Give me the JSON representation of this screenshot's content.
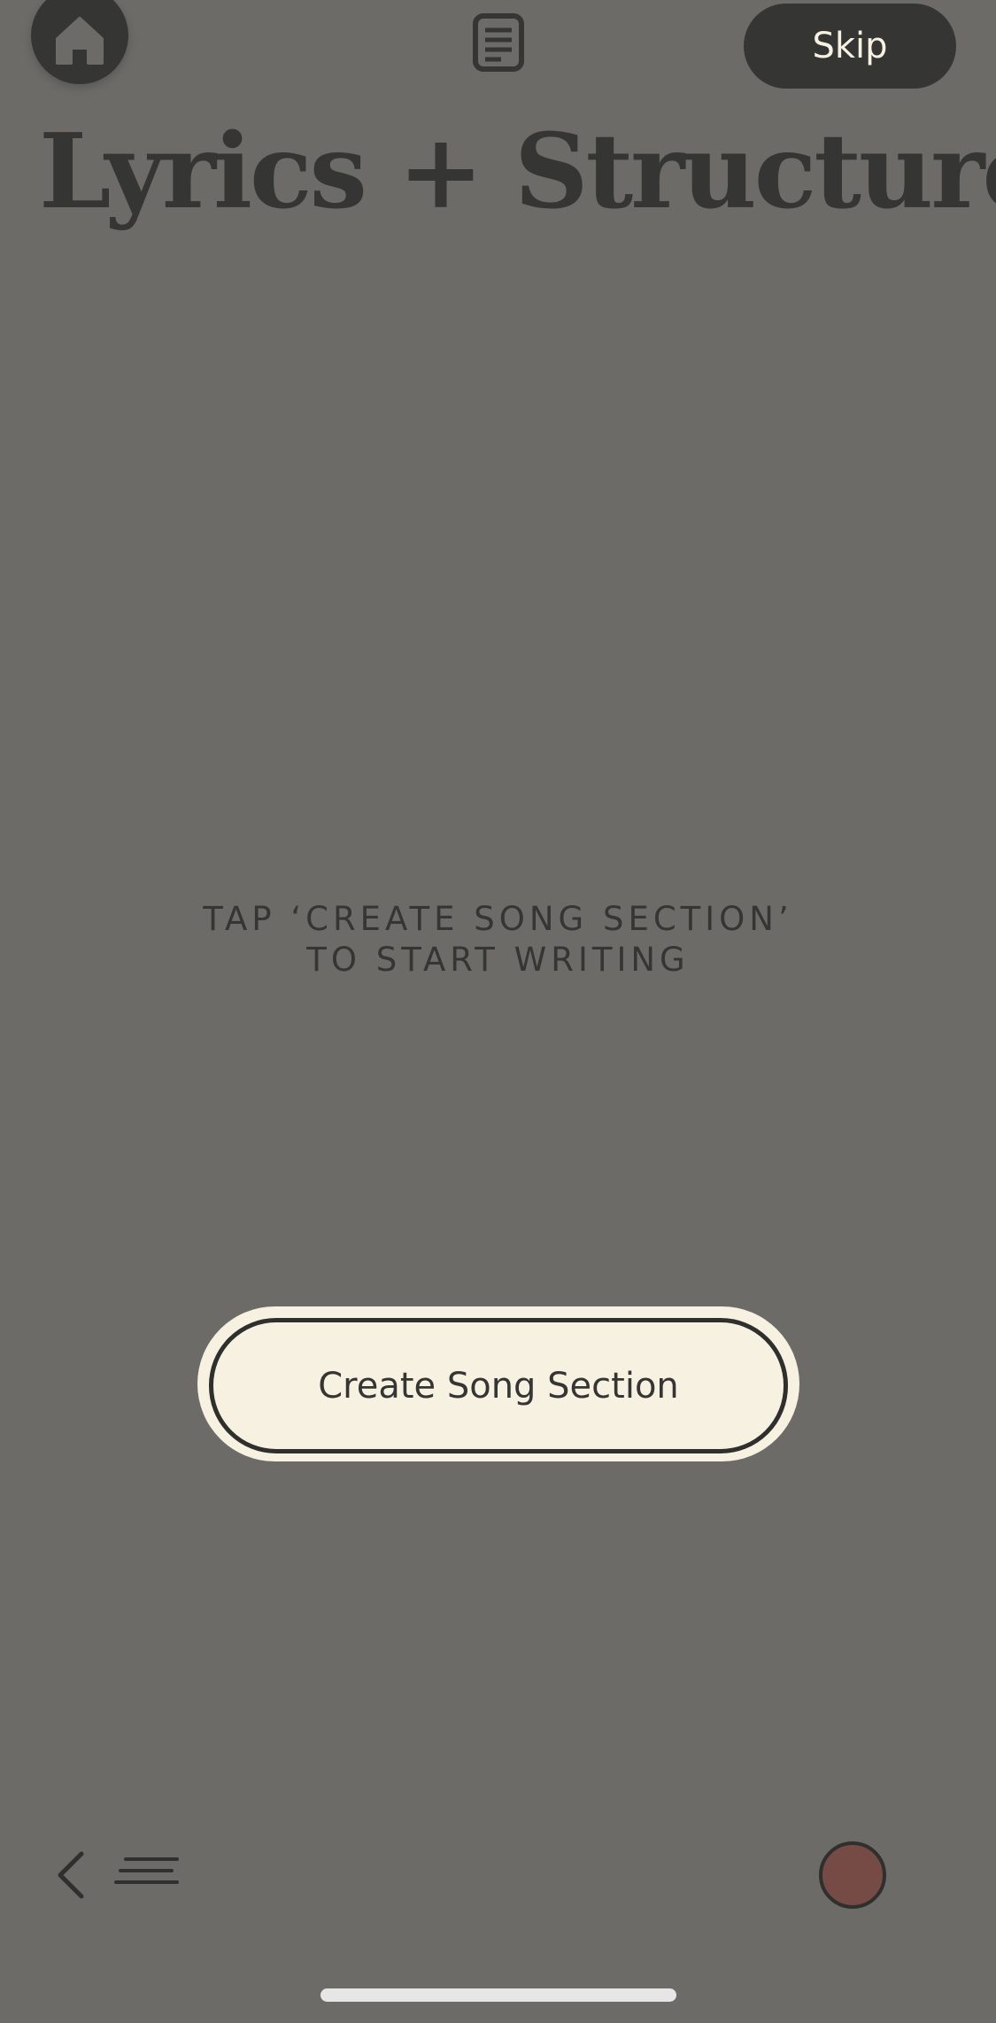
{
  "header": {
    "home_icon": "home-icon",
    "notes_icon": "document-icon",
    "skip_label": "Skip"
  },
  "page": {
    "title": "Lyrics + Structure"
  },
  "empty_state": {
    "line1": "TAP ‘CREATE SONG SECTION’",
    "line2": "TO START WRITING"
  },
  "actions": {
    "create_label": "Create Song Section"
  },
  "footer": {
    "back_icon": "chevron-left-icon",
    "menu_icon": "menu-icon",
    "record_icon": "record-icon"
  },
  "colors": {
    "background": "#6c6b67",
    "dark": "#353533",
    "cream": "#f7f1e2",
    "record": "#764b45"
  }
}
